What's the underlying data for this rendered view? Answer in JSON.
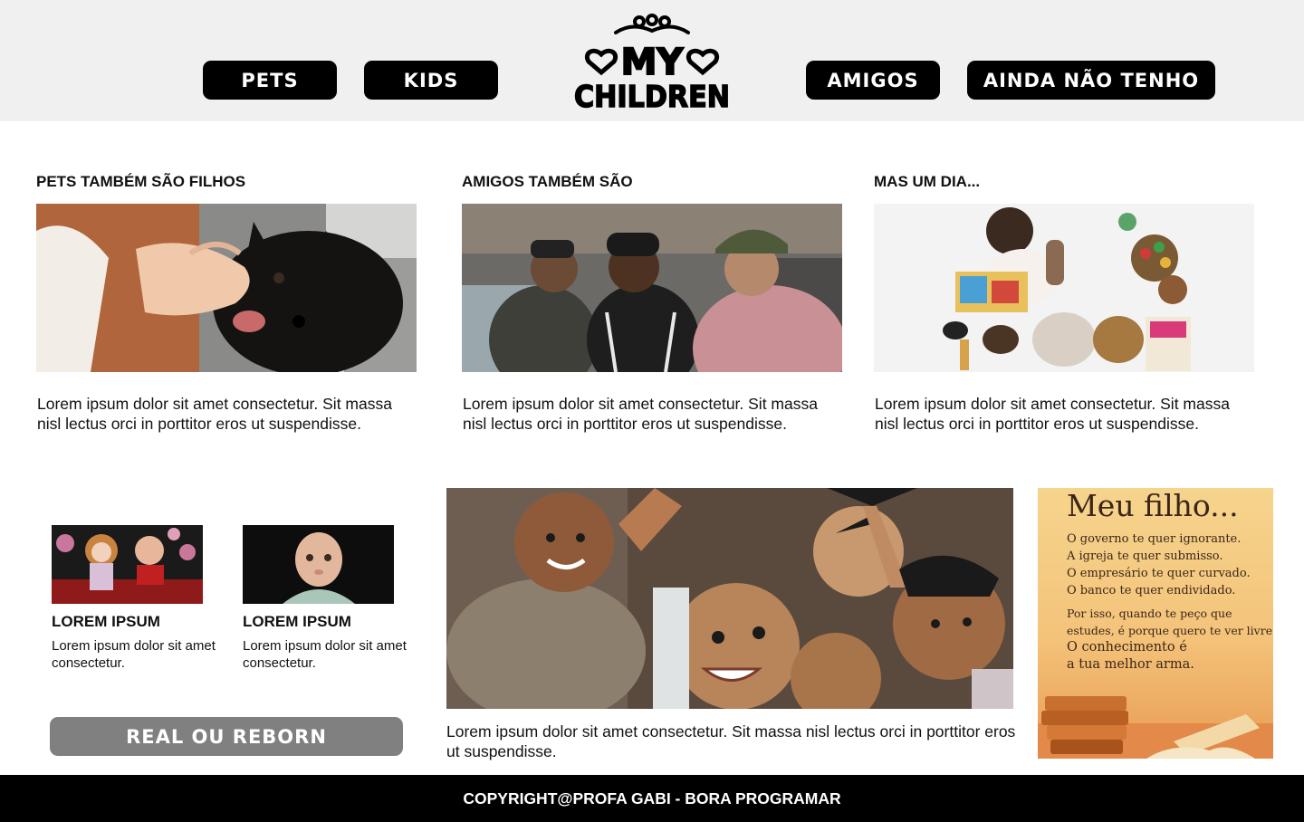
{
  "nav": {
    "left_items": [
      {
        "label": "PETS"
      },
      {
        "label": "KIDS"
      }
    ],
    "right_items": [
      {
        "label": "AMIGOS"
      },
      {
        "label": "AINDA NÃO TENHO"
      }
    ],
    "logo": {
      "line1": "MY",
      "line2": "CHILDREN"
    }
  },
  "cards": [
    {
      "title": "PETS TAMBÉM SÃO FILHOS",
      "text": "Lorem ipsum dolor sit amet consectetur. Sit massa nisl lectus orci in porttitor eros ut suspendisse."
    },
    {
      "title": "AMIGOS TAMBÉM SÃO",
      "text": "Lorem ipsum dolor sit amet consectetur. Sit massa nisl lectus orci in porttitor eros ut suspendisse."
    },
    {
      "title": "MAS UM DIA...",
      "text": "Lorem ipsum dolor sit amet consectetur. Sit massa nisl lectus orci in porttitor eros ut suspendisse."
    }
  ],
  "mini_cards": [
    {
      "title": "LOREM IPSUM",
      "text": "Lorem ipsum dolor sit amet consectetur."
    },
    {
      "title": "LOREM IPSUM",
      "text": "Lorem ipsum dolor sit amet consectetur."
    }
  ],
  "reborn_button": "REAL OU REBORN",
  "hero": {
    "text": "Lorem ipsum dolor sit amet consectetur. Sit massa nisl lectus orci in porttitor eros ut suspendisse."
  },
  "poster": {
    "title": "Meu filho...",
    "lines1": [
      "O governo te quer ignorante.",
      "A igreja te quer submisso.",
      "O empresário te quer curvado.",
      "O banco te quer endividado."
    ],
    "lines2": [
      "Por isso, quando te peço que",
      "estudes, é porque quero te ver livre."
    ],
    "lines3": [
      "O conhecimento é",
      "a tua melhor arma."
    ]
  },
  "footer": {
    "text": "COPYRIGHT@PROFA GABI - BORA PROGRAMAR"
  }
}
